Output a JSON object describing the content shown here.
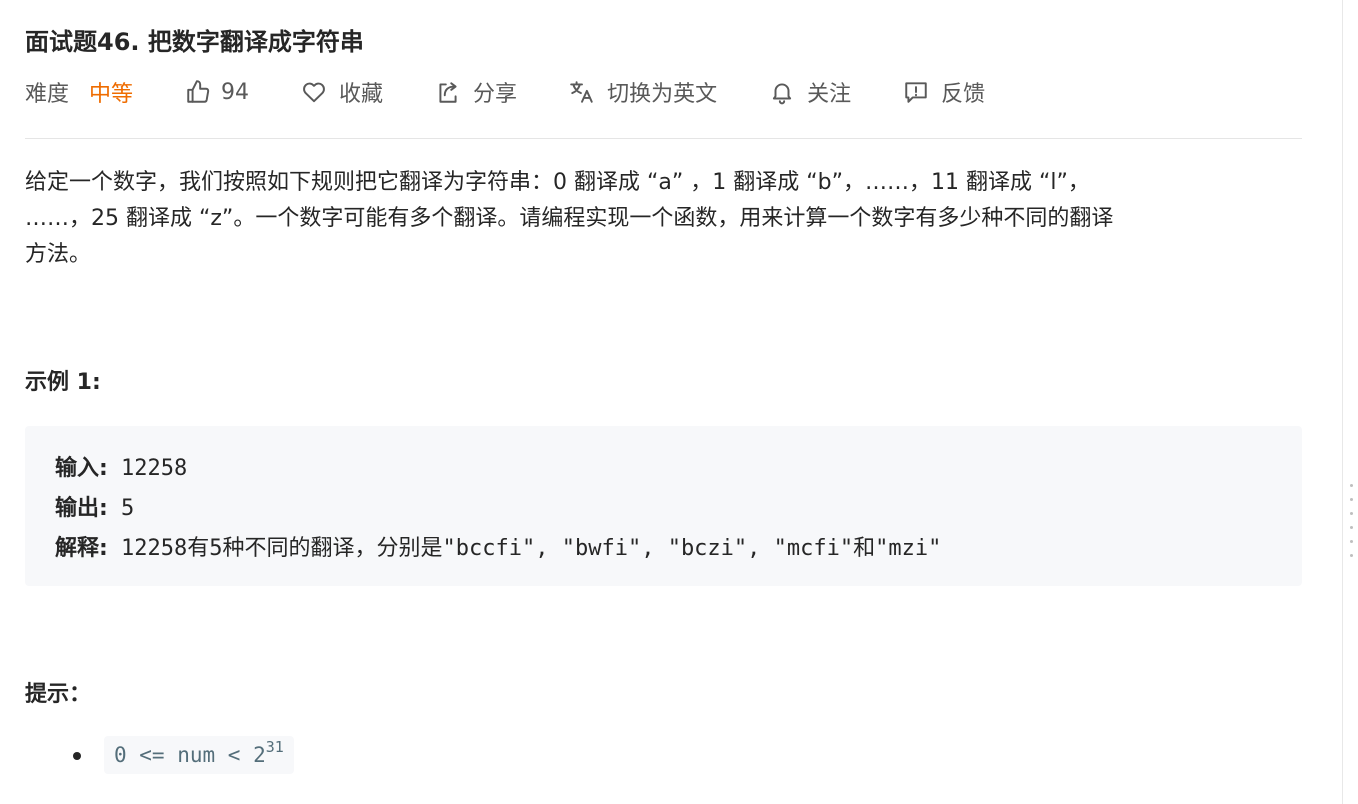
{
  "problem": {
    "title": "面试题46. 把数字翻译成字符串",
    "difficulty_label": "难度",
    "difficulty_value": "中等",
    "likes": "94",
    "actions": {
      "favorite": "收藏",
      "share": "分享",
      "translate": "切换为英文",
      "follow": "关注",
      "feedback": "反馈"
    },
    "description_lines": [
      "给定一个数字，我们按照如下规则把它翻译为字符串：0 翻译成 “a” ，1 翻译成 “b”，……，11 翻译成 “l”，",
      "……，25 翻译成 “z”。一个数字可能有多个翻译。请编程实现一个函数，用来计算一个数字有多少种不同的翻译",
      "方法。"
    ]
  },
  "example": {
    "title": "示例 1:",
    "input_label": "输入:",
    "input_value": " 12258",
    "output_label": "输出:",
    "output_value": " 5",
    "explain_label": "解释:",
    "explain_value": " 12258有5种不同的翻译，分别是\"bccfi\", \"bwfi\", \"bczi\", \"mcfi\"和\"mzi\""
  },
  "hints": {
    "title": "提示：",
    "constraint_text": "0 <= num < 2",
    "constraint_exponent": "31"
  },
  "colors": {
    "difficulty_medium": "#ef6c00",
    "text": "#262626",
    "muted": "#595959",
    "code_bg": "#f7f8fa",
    "code_text": "#546e7a"
  },
  "icons": [
    "thumbs-up-icon",
    "heart-icon",
    "share-icon",
    "translate-icon",
    "bell-icon",
    "feedback-icon"
  ]
}
